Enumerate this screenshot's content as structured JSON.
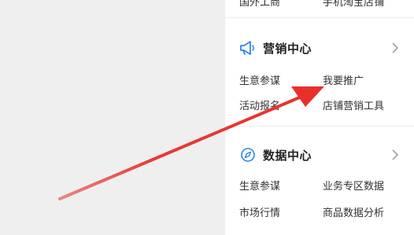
{
  "top_cut_row": {
    "left": "国外工商",
    "right": "手机淘宝店铺"
  },
  "marketing": {
    "title": "营销中心",
    "icon": "megaphone-icon",
    "links": {
      "r1c1": "生意参谋",
      "r1c2": "我要推广",
      "r2c1": "活动报名",
      "r2c2": "店铺营销工具"
    }
  },
  "data_center": {
    "title": "数据中心",
    "icon": "compass-icon",
    "links": {
      "r1c1": "生意参谋",
      "r1c2": "业务专区数据",
      "r2c1": "市场行情",
      "r2c2": "商品数据分析"
    }
  },
  "colors": {
    "accent_blue": "#2f86ea",
    "arrow_red": "#e8302b"
  }
}
